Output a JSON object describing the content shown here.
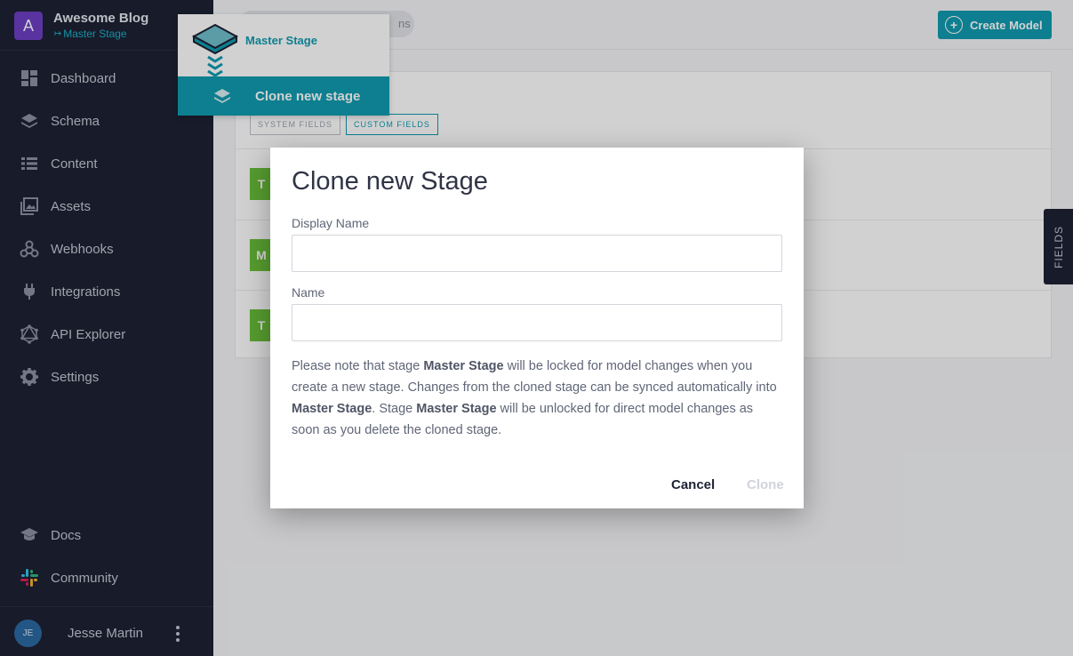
{
  "project": {
    "avatar_letter": "A",
    "name": "Awesome Blog",
    "stage": "Master Stage"
  },
  "nav": {
    "items": [
      {
        "label": "Dashboard",
        "icon": "dashboard-icon"
      },
      {
        "label": "Schema",
        "icon": "layers-icon"
      },
      {
        "label": "Content",
        "icon": "list-icon"
      },
      {
        "label": "Assets",
        "icon": "image-icon"
      },
      {
        "label": "Webhooks",
        "icon": "webhook-icon"
      },
      {
        "label": "Integrations",
        "icon": "plug-icon"
      },
      {
        "label": "API Explorer",
        "icon": "graphql-icon"
      },
      {
        "label": "Settings",
        "icon": "gear-icon"
      }
    ],
    "bottom": [
      {
        "label": "Docs",
        "icon": "graduation-cap-icon"
      },
      {
        "label": "Community",
        "icon": "slack-icon"
      }
    ]
  },
  "user": {
    "initials": "JE",
    "name": "Jesse Martin"
  },
  "topbar": {
    "pill_text": "ns",
    "create_label": "Create Model"
  },
  "panel": {
    "tags": [
      "SYSTEM FIELDS",
      "CUSTOM FIELDS"
    ],
    "rows": [
      {
        "chip": "T"
      },
      {
        "chip": "M"
      },
      {
        "chip": "T"
      }
    ]
  },
  "fields_tab": "FIELDS",
  "stage_menu": {
    "current": "Master Stage",
    "clone_label": "Clone new stage"
  },
  "modal": {
    "title": "Clone new Stage",
    "display_name_label": "Display Name",
    "display_name_value": "",
    "name_label": "Name",
    "name_value": "",
    "note_parts": {
      "p1": "Please note that stage ",
      "b1": "Master Stage",
      "p2": " will be locked for model changes when you create a new stage. Changes from the cloned stage can be synced automatically into ",
      "b2": "Master Stage",
      "p3": ". Stage ",
      "b3": "Master Stage",
      "p4": " will be unlocked for direct model changes as soon as you delete the cloned stage."
    },
    "cancel_label": "Cancel",
    "clone_label": "Clone"
  },
  "colors": {
    "sidebar": "#1d2234",
    "accent": "#109bb0",
    "project_avatar": "#6d3fc4",
    "chip_green": "#6abf3a"
  }
}
